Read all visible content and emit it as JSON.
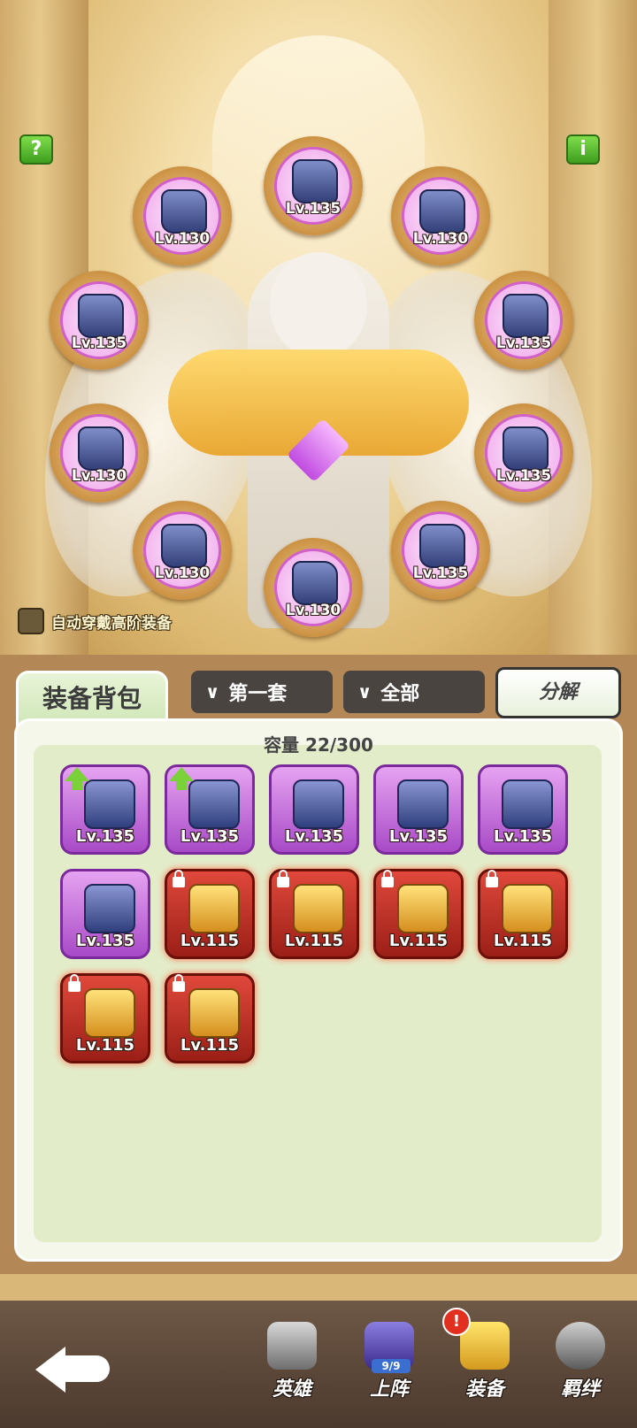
{
  "top_buttons": {
    "help": "?",
    "info": "i"
  },
  "equipped_slots": [
    {
      "level": "Lv.135"
    },
    {
      "level": "Lv.130"
    },
    {
      "level": "Lv.130"
    },
    {
      "level": "Lv.135"
    },
    {
      "level": "Lv.135"
    },
    {
      "level": "Lv.130"
    },
    {
      "level": "Lv.135"
    },
    {
      "level": "Lv.130"
    },
    {
      "level": "Lv.135"
    },
    {
      "level": "Lv.130"
    }
  ],
  "auto_equip": {
    "label": "自动穿戴高阶装备",
    "checked": false
  },
  "panel": {
    "tab_label": "装备背包",
    "filter_set": "第一套",
    "filter_all": "全部",
    "decompose_label": "分解",
    "capacity": "容量 22/300"
  },
  "items": [
    {
      "level": "Lv.135",
      "rarity": "purple",
      "upgrade": true
    },
    {
      "level": "Lv.135",
      "rarity": "purple",
      "upgrade": true
    },
    {
      "level": "Lv.135",
      "rarity": "purple"
    },
    {
      "level": "Lv.135",
      "rarity": "purple"
    },
    {
      "level": "Lv.135",
      "rarity": "purple"
    },
    {
      "level": "Lv.135",
      "rarity": "purple"
    },
    {
      "level": "Lv.115",
      "rarity": "red",
      "locked": true
    },
    {
      "level": "Lv.115",
      "rarity": "red",
      "locked": true
    },
    {
      "level": "Lv.115",
      "rarity": "red",
      "locked": true
    },
    {
      "level": "Lv.115",
      "rarity": "red",
      "locked": true
    },
    {
      "level": "Lv.115",
      "rarity": "red",
      "locked": true
    },
    {
      "level": "Lv.115",
      "rarity": "red",
      "locked": true
    }
  ],
  "nav": {
    "heroes": "英雄",
    "lineup": "上阵",
    "lineup_count": "9/9",
    "equipment": "装备",
    "equipment_alert": "!",
    "bond": "羁绊"
  },
  "colors": {
    "accent_green": "#3e9f1f",
    "purple_rarity": "#a84ac7",
    "red_rarity": "#9b1f17"
  }
}
